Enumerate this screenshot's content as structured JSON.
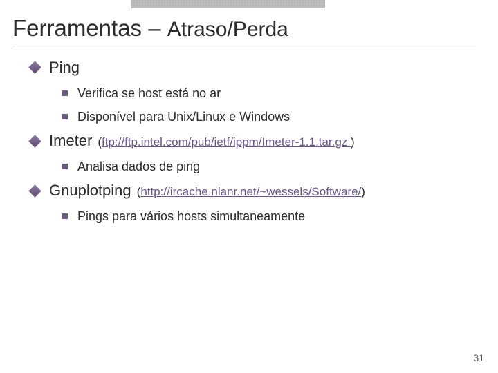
{
  "title_main": "Ferramentas –",
  "title_sub": "Atraso/Perda",
  "sections": [
    {
      "heading": "Ping",
      "link_label": "",
      "link_open": "",
      "link_close": "",
      "subs": [
        "Verifica se host está no ar",
        "Disponível para Unix/Linux e Windows"
      ]
    },
    {
      "heading": "Imeter",
      "link_open": "(",
      "link_label": "ftp://ftp.intel.com/pub/ietf/ippm/Imeter-1.1.tar.gz ",
      "link_close": ")",
      "subs": [
        "Analisa dados de ping"
      ]
    },
    {
      "heading": "Gnuplotping",
      "link_open": "(",
      "link_label": "http://ircache.nlanr.net/~wessels/Software/",
      "link_close": ")",
      "subs": [
        "Pings para vários hosts simultaneamente"
      ]
    }
  ],
  "page_number": "31"
}
